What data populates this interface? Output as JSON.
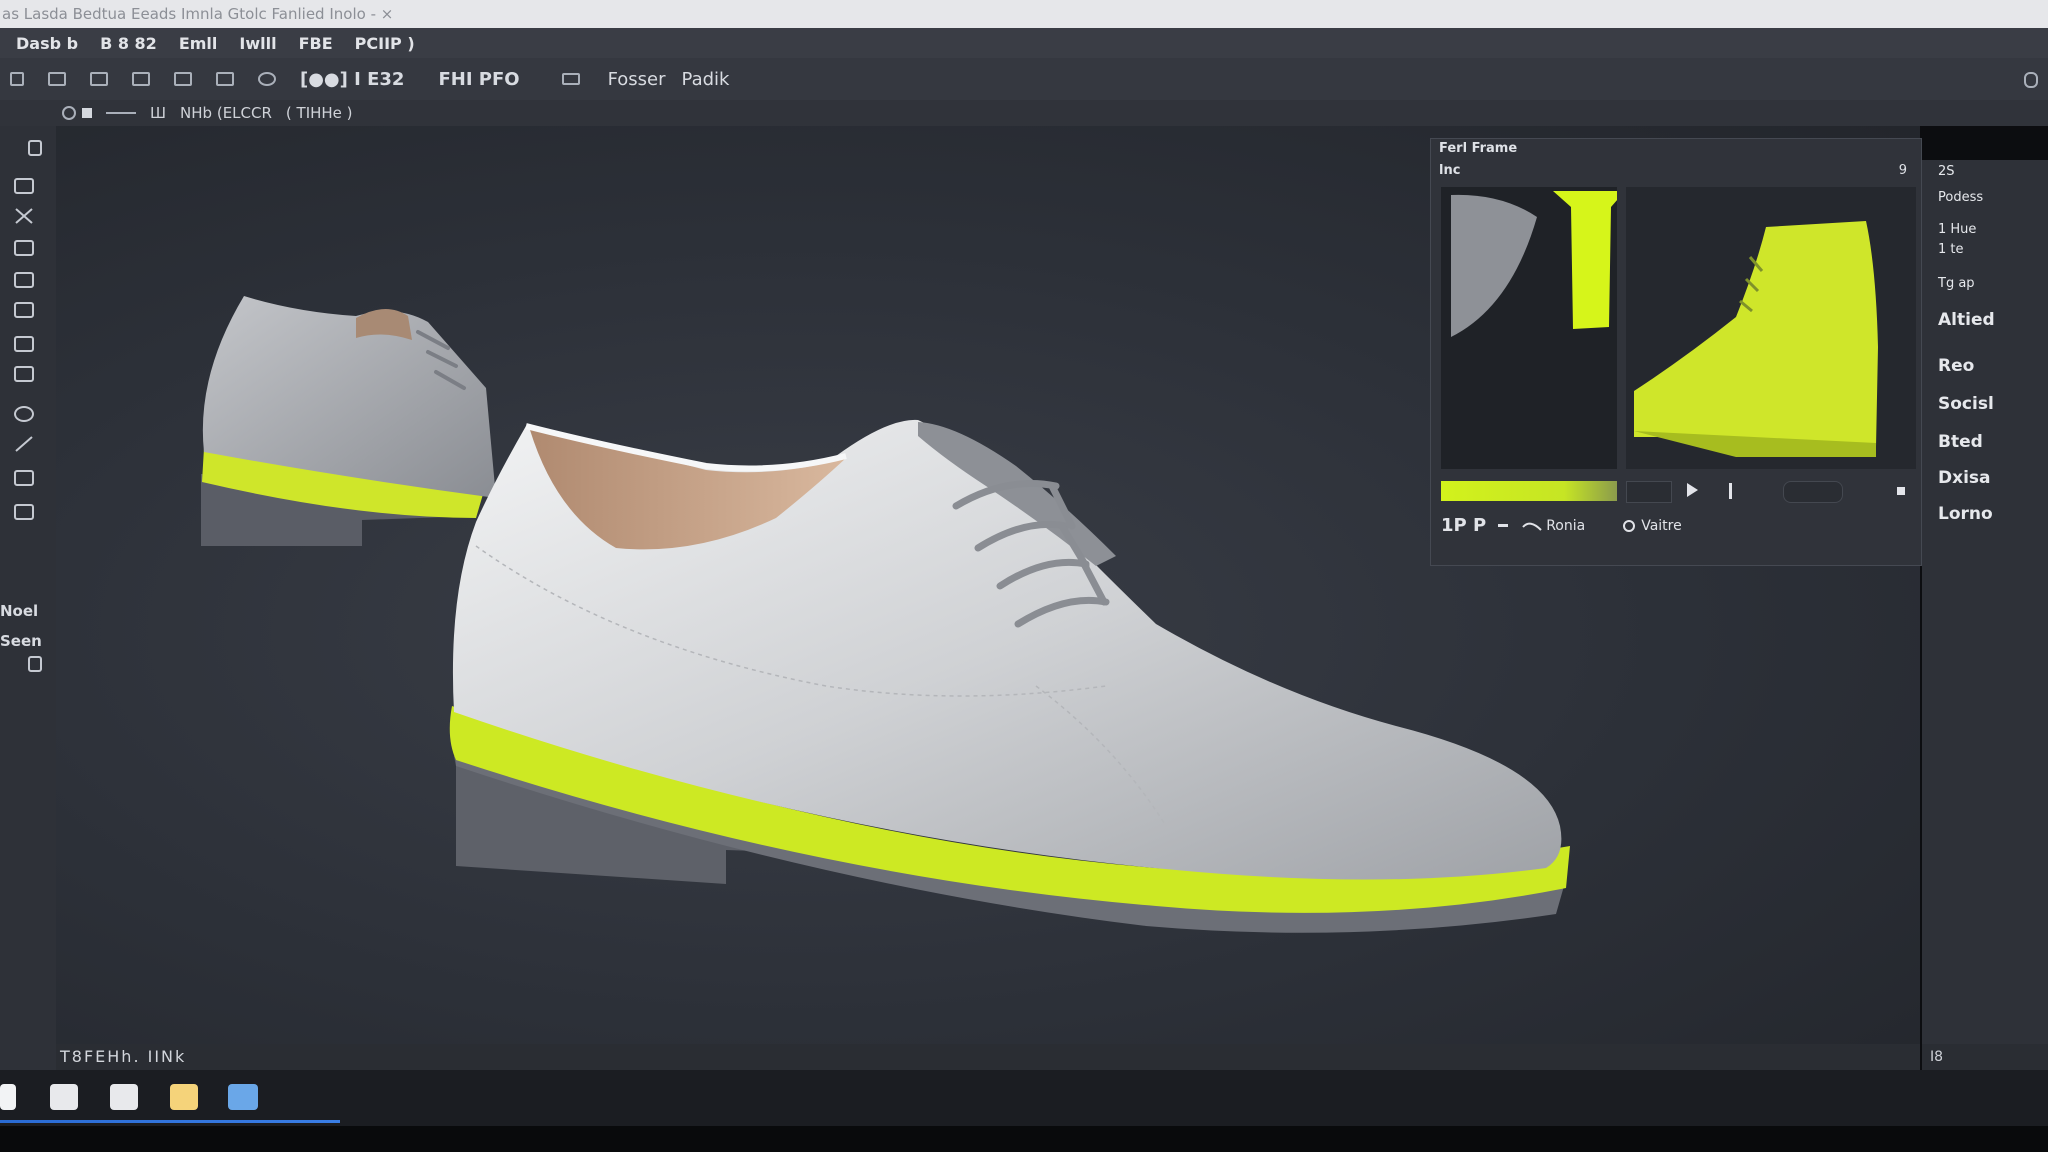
{
  "title_bar": {
    "text": "as Lasda Bedtua  Eeads Imnla Gtolc Fanlied Inolo  -  ×"
  },
  "menu": {
    "items": [
      "Dasb b",
      "B 8 82",
      "Emll",
      "Iwlll",
      "FBE",
      "PCIIP )"
    ]
  },
  "toolbar": {
    "items": [
      "[●●] I E32",
      "FHI PFO",
      "Fosser",
      "Padik"
    ]
  },
  "options_bar": {
    "items": [
      "Ш",
      "NHb (ELCCR",
      "( TIHHe )"
    ]
  },
  "left_panel": {
    "labels": [
      "Noel",
      "Seen"
    ]
  },
  "material_panel": {
    "title": "Ferl Frame",
    "tab": "lnc",
    "count": "9",
    "row_label_1": "1P P",
    "row_label_2": "Ronia",
    "row_label_3": "Vaitre",
    "swatch_color": "#d6f51a"
  },
  "right_panel": {
    "items": [
      {
        "label": "2S",
        "small": true
      },
      {
        "label": "Podess",
        "small": true
      },
      {
        "label": "1 Hue",
        "small": true
      },
      {
        "label": "1 te",
        "small": true
      },
      {
        "label": "Tg ap",
        "small": true
      },
      {
        "label": "Altied",
        "small": false
      },
      {
        "label": "Reo",
        "small": false
      },
      {
        "label": "Socisl",
        "small": false
      },
      {
        "label": "Bted",
        "small": false
      },
      {
        "label": "Dxisa",
        "small": false
      },
      {
        "label": "Lorno",
        "small": false
      }
    ]
  },
  "status_bar": {
    "text": "T8FEHh. IINk",
    "right_text": "I8"
  },
  "colors": {
    "accent": "#d6f51a",
    "shoe_upper": "#cfd1d4",
    "sole_base": "#5e6169",
    "background": "#2c3038"
  }
}
